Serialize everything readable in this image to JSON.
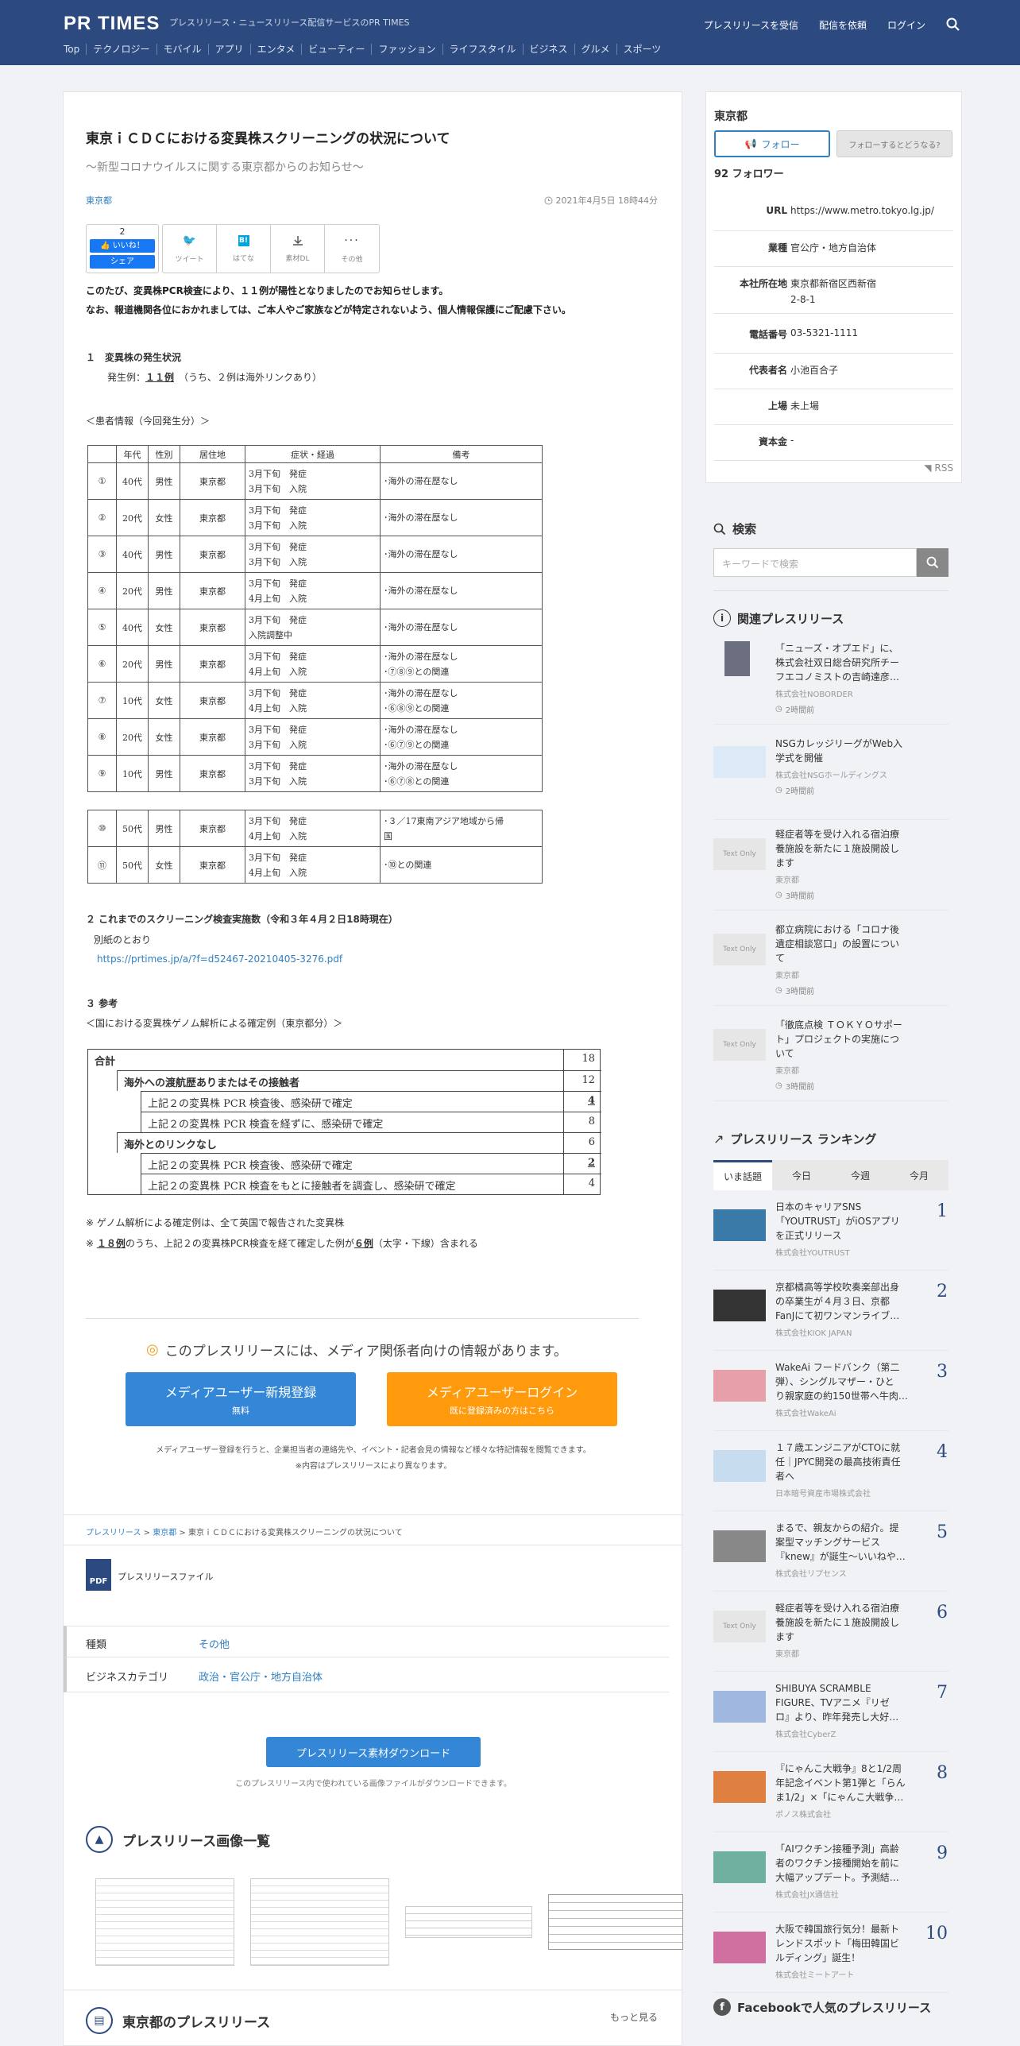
{
  "header": {
    "logo": "PR TIMES",
    "tagline": "プレスリリース・ニュースリリース配信サービスのPR TIMES",
    "nav": [
      "プレスリリースを受信",
      "配信を依頼",
      "ログイン"
    ],
    "categories": [
      "Top",
      "テクノロジー",
      "モバイル",
      "アプリ",
      "エンタメ",
      "ビューティー",
      "ファッション",
      "ライフスタイル",
      "ビジネス",
      "グルメ",
      "スポーツ"
    ]
  },
  "article": {
    "title": "東京ｉＣＤＣにおける変異株スクリーニングの状況について",
    "subtitle": "～新型コロナウイルスに関する東京都からのお知らせ～",
    "company": "東京都",
    "date": "2021年4月5日 18時44分",
    "like_count": "2",
    "like_label": "いいね！",
    "share_label": "シェア",
    "share": [
      "ツイート",
      "はてな",
      "素材DL",
      "その他"
    ],
    "intro1": "このたび、変異株PCR検査により、１１例が陽性となりましたのでお知らせします。",
    "intro2": "なお、報道機関各位におかれましては、ご本人やご家族などが特定されないよう、個人情報保護にご配慮下さい。",
    "s1_title": "１　変異株の発生状況",
    "s1_cases_prefix": "発生例：",
    "s1_cases": "１１例",
    "s1_cases_note": "（うち、２例は海外リンクあり）",
    "patient_heading": "＜患者情報（今回発生分）＞",
    "patient_headers": [
      "年代",
      "性別",
      "居住地",
      "症状・経過",
      "備考"
    ],
    "patients": [
      [
        "①",
        "40代",
        "男性",
        "東京都",
        "3月下旬　発症",
        "3月下旬　入院",
        "･海外の滞在歴なし",
        ""
      ],
      [
        "②",
        "20代",
        "女性",
        "東京都",
        "3月下旬　発症",
        "3月下旬　入院",
        "･海外の滞在歴なし",
        ""
      ],
      [
        "③",
        "40代",
        "男性",
        "東京都",
        "3月下旬　発症",
        "3月下旬　入院",
        "･海外の滞在歴なし",
        ""
      ],
      [
        "④",
        "20代",
        "男性",
        "東京都",
        "3月下旬　発症",
        "4月上旬　入院",
        "･海外の滞在歴なし",
        ""
      ],
      [
        "⑤",
        "40代",
        "女性",
        "東京都",
        "3月下旬　発症",
        "入院調整中",
        "･海外の滞在歴なし",
        ""
      ],
      [
        "⑥",
        "20代",
        "男性",
        "東京都",
        "3月下旬　発症",
        "4月上旬　入院",
        "･海外の滞在歴なし",
        "･⑦⑧⑨との関連"
      ],
      [
        "⑦",
        "10代",
        "女性",
        "東京都",
        "3月下旬　発症",
        "4月上旬　入院",
        "･海外の滞在歴なし",
        "･⑥⑧⑨との関連"
      ],
      [
        "⑧",
        "20代",
        "女性",
        "東京都",
        "3月下旬　発症",
        "3月下旬　入院",
        "･海外の滞在歴なし",
        "･⑥⑦⑨との関連"
      ],
      [
        "⑨",
        "10代",
        "男性",
        "東京都",
        "3月下旬　発症",
        "3月下旬　入院",
        "･海外の滞在歴なし",
        "･⑥⑦⑧との関連"
      ]
    ],
    "patients2": [
      [
        "⑩",
        "50代",
        "男性",
        "東京都",
        "3月下旬　発症",
        "4月上旬　入院",
        "･３／17東南アジア地域から帰",
        "国"
      ],
      [
        "⑪",
        "50代",
        "女性",
        "東京都",
        "3月下旬　発症",
        "4月上旬　入院",
        "･⑩との関連",
        ""
      ]
    ],
    "s2_title": "２ これまでのスクリーニング検査実施数（令和３年４月２日18時現在）",
    "s2_text": "別紙のとおり",
    "s2_link": "https://prtimes.jp/a/?f=d52467-20210405-3276.pdf",
    "s3_title": "３ 参考",
    "s3_heading": "＜国における変異株ゲノム解析による確定例（東京都分）＞",
    "ref_rows": [
      [
        "合計",
        "18"
      ],
      [
        "海外への渡航歴ありまたはその接触者",
        "12"
      ],
      [
        "上記２の変異株 PCR 検査後、感染研で確定",
        "4"
      ],
      [
        "上記２の変異株 PCR 検査を経ずに、感染研で確定",
        "8"
      ],
      [
        "海外とのリンクなし",
        "6"
      ],
      [
        "上記２の変異株 PCR 検査後、感染研で確定",
        "2"
      ],
      [
        "上記２の変異株 PCR 検査をもとに接触者を調査し、感染研で確定",
        "4"
      ]
    ],
    "note1": "※ ゲノム解析による確定例は、全て英国で報告された変異株",
    "note2_a": "※ ",
    "note2_b": "１８例",
    "note2_c": "のうち、上記２の変異株PCR検査を経て確定した例が",
    "note2_d": "６例",
    "note2_e": "（太字・下線）含まれる"
  },
  "media": {
    "title": "このプレスリリースには、メディア関係者向けの情報があります。",
    "reg": "メディアユーザー新規登録",
    "reg_sub": "無料",
    "login": "メディアユーザーログイン",
    "login_sub": "既に登録済みの方はこちら",
    "note1": "メディアユーザー登録を行うと、企業担当者の連絡先や、イベント・記者会見の情報など様々な特記情報を閲覧できます。",
    "note2": "※内容はプレスリリースにより異なります。"
  },
  "breadcrumb": [
    "プレスリリース",
    "東京都",
    "東京ｉＣＤＣにおける変異株スクリーニングの状況について"
  ],
  "file_label": "プレスリリースファイル",
  "pdf": "PDF",
  "meta": {
    "kind_label": "種類",
    "kind": "その他",
    "cat_label": "ビジネスカテゴリ",
    "cat": "政治・官公庁・地方自治体"
  },
  "download": {
    "button": "プレスリリース素材ダウンロード",
    "note": "このプレスリリース内で使われている画像ファイルがダウンロードできます。"
  },
  "images_title": "プレスリリース画像一覧",
  "bottom": {
    "title": "東京都のプレスリリース",
    "more": "もっと見る"
  },
  "company_card": {
    "name": "東京都",
    "follow": "フォロー",
    "follow_q": "フォローするとどうなる?",
    "followers": "92 フォロワー",
    "rows": [
      [
        "URL",
        "https://www.metro.tokyo.lg.jp/"
      ],
      [
        "業種",
        "官公庁・地方自治体"
      ],
      [
        "本社所在地",
        "東京都新宿区西新宿"
      ],
      [
        "電話番号",
        "03-5321-1111"
      ],
      [
        "代表者名",
        "小池百合子"
      ],
      [
        "上場",
        "未上場"
      ],
      [
        "資本金",
        "-"
      ]
    ],
    "address2": "2-8-1",
    "rss": "RSS"
  },
  "search": {
    "title": "検索",
    "placeholder": "キーワードで検索"
  },
  "related": {
    "title": "関連プレスリリース",
    "items": [
      {
        "t1": "「ニューズ・オプエド」に、",
        "t2": "株式会社双日総合研究所チー",
        "t3": "フエコノミストの吉崎達彦…",
        "co": "株式会社NOBORDER",
        "time": "2時間前"
      },
      {
        "t1": "NSGカレッジリーグがWeb入",
        "t2": "学式を開催",
        "t3": "",
        "co": "株式会社NSGホールディングス",
        "time": "2時間前"
      },
      {
        "t1": "軽症者等を受け入れる宿泊療",
        "t2": "養施設を新たに１施設開設し",
        "t3": "ます",
        "co": "東京都",
        "time": "3時間前"
      },
      {
        "t1": "都立病院における「コロナ後",
        "t2": "遺症相談窓口」の設置につい",
        "t3": "て",
        "co": "東京都",
        "time": "3時間前"
      },
      {
        "t1": "「徹底点検 ＴＯＫＹＯサポー",
        "t2": "ト」プロジェクトの実施につ",
        "t3": "いて",
        "co": "東京都",
        "time": "3時間前"
      }
    ],
    "text_only": "Text Only"
  },
  "ranking": {
    "title": "プレスリリース ランキング",
    "tabs": [
      "いま話題",
      "今日",
      "今週",
      "今月"
    ],
    "items": [
      {
        "n": "1",
        "t1": "日本のキャリアSNS",
        "t2": "「YOUTRUST」がiOSアプリ",
        "t3": "を正式リリース",
        "co": "株式会社YOUTRUST"
      },
      {
        "n": "2",
        "t1": "京都橘高等学校吹奏楽部出身",
        "t2": "の卒業生が４月３日、京都",
        "t3": "FanJにて初ワンマンライブ…",
        "co": "株式会社KIOK JAPAN"
      },
      {
        "n": "3",
        "t1": "WakeAi フードバンク（第二",
        "t2": "弾）、シングルマザー・ひと",
        "t3": "り親家庭の約150世帯へ牛肉…",
        "co": "株式会社WakeAi"
      },
      {
        "n": "4",
        "t1": "１７歳エンジニアがCTOに就",
        "t2": "任｜JPYC開発の最高技術責任",
        "t3": "者へ",
        "co": "日本暗号資産市場株式会社"
      },
      {
        "n": "5",
        "t1": "まるで、親友からの紹介。提",
        "t2": "案型マッチングサービス",
        "t3": "『knew』が誕生～いいねや…",
        "co": "株式会社リプセンス"
      },
      {
        "n": "6",
        "t1": "軽症者等を受け入れる宿泊療",
        "t2": "養施設を新たに１施設開設し",
        "t3": "ます",
        "co": "東京都"
      },
      {
        "n": "7",
        "t1": "SHIBUYA SCRAMBLE",
        "t2": "FIGURE、TVアニメ『リゼ",
        "t3": "ロ』より、昨年発売し大好…",
        "co": "株式会社CyberZ"
      },
      {
        "n": "8",
        "t1": "『にゃんこ大戦争』8と1/2周",
        "t2": "年記念イベント第1弾と「らん",
        "t3": "ま1/2」×「にゃんこ大戦争…",
        "co": "ポノス株式会社"
      },
      {
        "n": "9",
        "t1": "「AIワクチン接種予測」高齢",
        "t2": "者のワクチン接種開始を前に",
        "t3": "大幅アップデート。予測結…",
        "co": "株式会社JX通信社"
      },
      {
        "n": "10",
        "t1": "大阪で韓国旅行気分！最新ト",
        "t2": "レンドスポット「梅田韓国ビ",
        "t3": "ルディング」誕生！",
        "co": "株式会社ミートアート"
      }
    ]
  },
  "facebook": {
    "title": "Facebookで人気のプレスリリース"
  },
  "colors": {
    "header": "#2c4a80",
    "link": "#2f7fc1",
    "orange": "#ff9a0d",
    "blue_btn": "#3387d6"
  }
}
